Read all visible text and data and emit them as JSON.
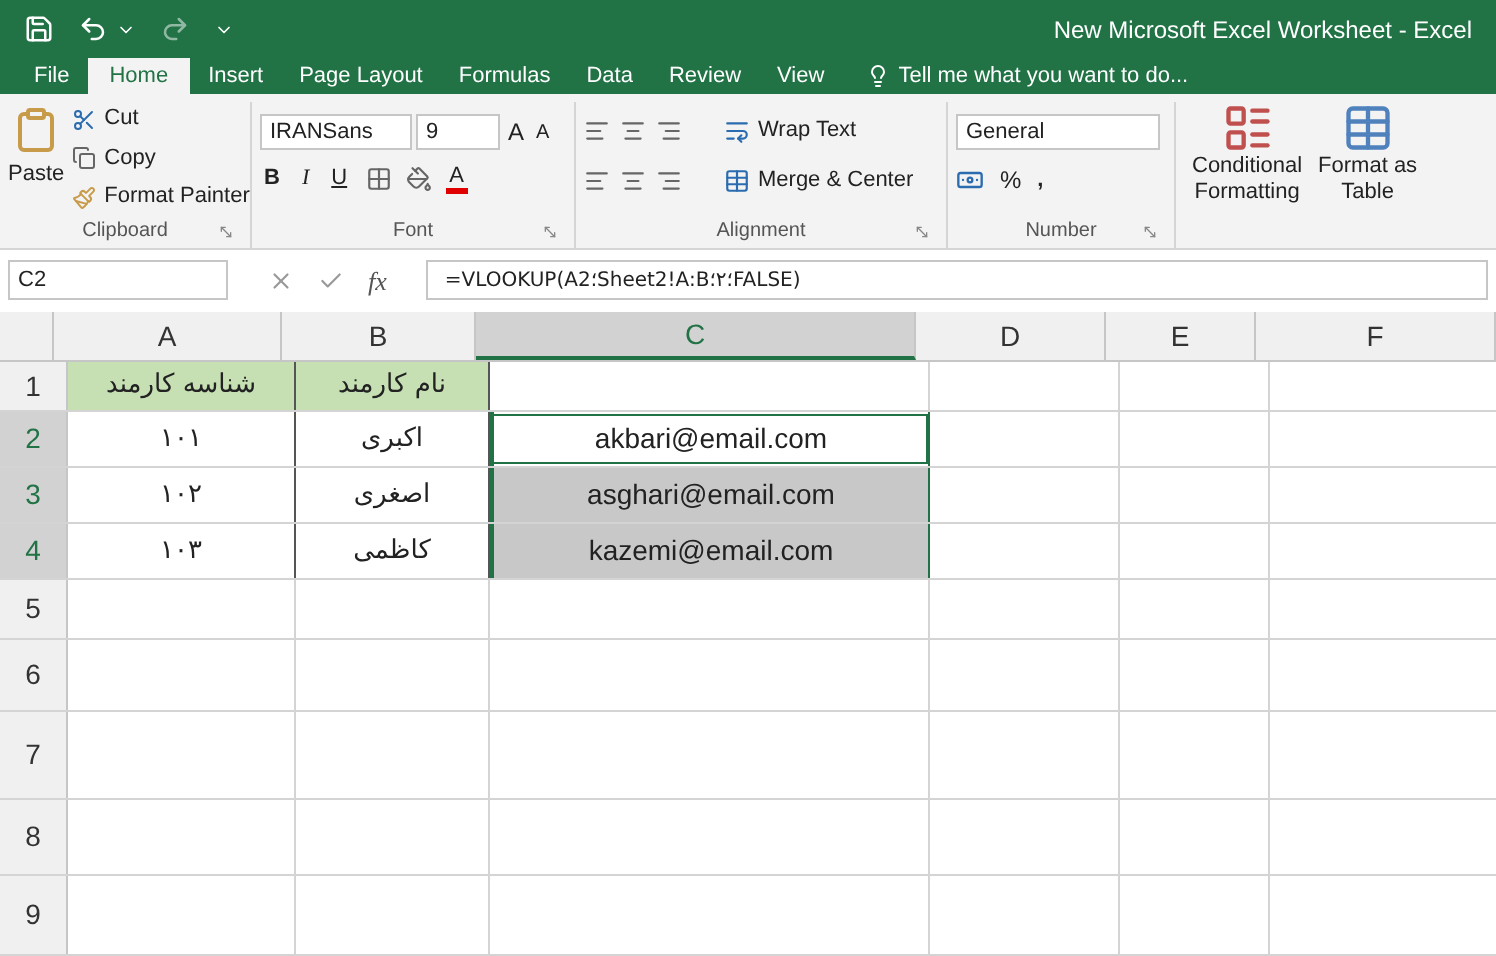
{
  "window": {
    "title": "New Microsoft Excel Worksheet - Excel"
  },
  "tabs": [
    {
      "label": "File",
      "selected": false
    },
    {
      "label": "Home",
      "selected": true
    },
    {
      "label": "Insert",
      "selected": false
    },
    {
      "label": "Page Layout",
      "selected": false
    },
    {
      "label": "Formulas",
      "selected": false
    },
    {
      "label": "Data",
      "selected": false
    },
    {
      "label": "Review",
      "selected": false
    },
    {
      "label": "View",
      "selected": false
    }
  ],
  "tell_me": {
    "placeholder": "Tell me what you want to do..."
  },
  "ribbon": {
    "clipboard": {
      "label": "Clipboard",
      "paste": "Paste",
      "cut": "Cut",
      "copy": "Copy",
      "format_painter": "Format Painter"
    },
    "font": {
      "label": "Font",
      "font_name": "IRANSans",
      "font_size": "9",
      "bold": "B",
      "italic": "I",
      "underline": "U",
      "grow": "A",
      "shrink": "A",
      "font_color": "A"
    },
    "alignment": {
      "label": "Alignment",
      "wrap_text": "Wrap Text",
      "merge_center": "Merge & Center"
    },
    "number": {
      "label": "Number",
      "format": "General",
      "percent": "%",
      "comma": ","
    },
    "styles": {
      "conditional_formatting": [
        "Conditional",
        "Formatting"
      ],
      "format_as_table": [
        "Format as",
        "Table"
      ]
    }
  },
  "formula_bar": {
    "name_box": "C2",
    "fx": "fx",
    "formula": "=VLOOKUP(A؛2Sheet2!A:B؛۲؛FALSE)"
  },
  "columns": [
    {
      "label": "A",
      "selected": false
    },
    {
      "label": "B",
      "selected": false
    },
    {
      "label": "C",
      "selected": true
    },
    {
      "label": "D",
      "selected": false
    },
    {
      "label": "E",
      "selected": false
    },
    {
      "label": "F",
      "selected": false
    }
  ],
  "rows": [
    {
      "number": "1",
      "selected": false,
      "cells": {
        "A": {
          "text": "شناسه کارمند",
          "kind": "header",
          "selected": false,
          "active": false
        },
        "B": {
          "text": "نام کارمند",
          "kind": "header",
          "selected": false,
          "active": false
        }
      }
    },
    {
      "number": "2",
      "selected": true,
      "cells": {
        "A": {
          "text": "۱۰۱",
          "kind": "data",
          "selected": false,
          "active": false
        },
        "B": {
          "text": "اکبری",
          "kind": "data",
          "selected": false,
          "active": false
        },
        "C": {
          "text": "akbari@email.com",
          "kind": "data",
          "selected": true,
          "active": true
        }
      }
    },
    {
      "number": "3",
      "selected": true,
      "cells": {
        "A": {
          "text": "۱۰۲",
          "kind": "data",
          "selected": false,
          "active": false
        },
        "B": {
          "text": "اصغری",
          "kind": "data",
          "selected": false,
          "active": false
        },
        "C": {
          "text": "asghari@email.com",
          "kind": "data",
          "selected": true,
          "active": false
        }
      }
    },
    {
      "number": "4",
      "selected": true,
      "cells": {
        "A": {
          "text": "۱۰۳",
          "kind": "data",
          "selected": false,
          "active": false
        },
        "B": {
          "text": "کاظمی",
          "kind": "data",
          "selected": false,
          "active": false
        },
        "C": {
          "text": "kazemi@email.com",
          "kind": "data",
          "selected": true,
          "active": false
        }
      }
    },
    {
      "number": "5",
      "selected": false
    },
    {
      "number": "6",
      "selected": false
    },
    {
      "number": "7",
      "selected": false
    },
    {
      "number": "8",
      "selected": false
    },
    {
      "number": "9",
      "selected": false
    }
  ]
}
